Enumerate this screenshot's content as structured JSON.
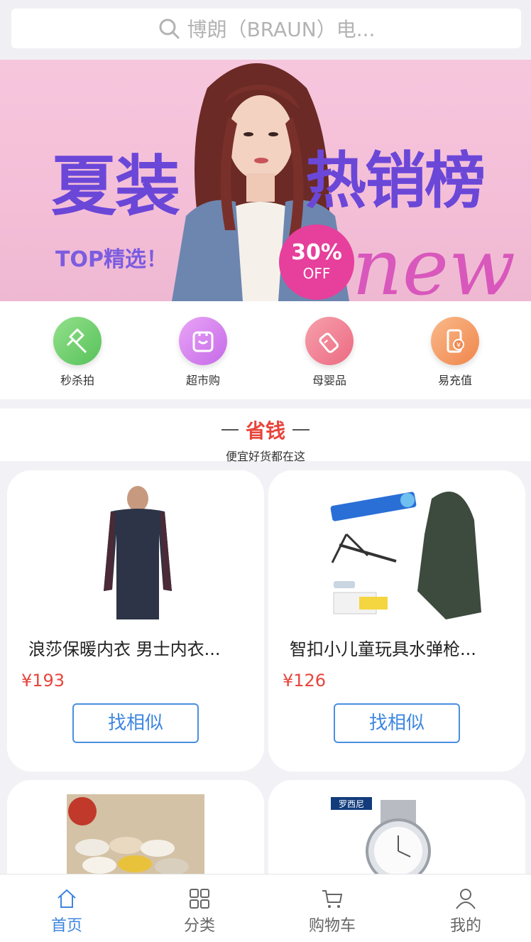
{
  "search": {
    "placeholder": "博朗（BRAUN）电..."
  },
  "banner": {
    "title_left": "夏装",
    "title_right": "热销榜",
    "tagline": "TOP精选！",
    "badge_percent": "30%",
    "badge_label": "OFF",
    "script_text": "new",
    "dots": 3,
    "active_dot": 1
  },
  "quick_menu": [
    {
      "label": "秒杀拍",
      "icon": "hammer-icon",
      "color": "#6fcf6a"
    },
    {
      "label": "超市购",
      "icon": "store-icon",
      "color": "#d884f0"
    },
    {
      "label": "母婴品",
      "icon": "baby-bottle-icon",
      "color": "#f07d92"
    },
    {
      "label": "易充值",
      "icon": "phone-recharge-icon",
      "color": "#f59a60"
    }
  ],
  "section": {
    "title": "省钱",
    "subtitle": "便宜好货都在这"
  },
  "products": [
    {
      "name": "浪莎保暖内衣 男士内衣...",
      "price": "¥193",
      "button": "找相似"
    },
    {
      "name": "智扣小儿童玩具水弹枪...",
      "price": "¥126",
      "button": "找相似"
    },
    {
      "name": "",
      "price": "",
      "button": ""
    },
    {
      "name": "",
      "price": "",
      "button": "",
      "brand": "罗西尼"
    }
  ],
  "tabbar": [
    {
      "label": "首页",
      "icon": "home-icon",
      "active": true
    },
    {
      "label": "分类",
      "icon": "grid-icon",
      "active": false
    },
    {
      "label": "购物车",
      "icon": "cart-icon",
      "active": false
    },
    {
      "label": "我的",
      "icon": "user-icon",
      "active": false
    }
  ],
  "colors": {
    "accent": "#3e86e0",
    "price": "#e8453c"
  }
}
